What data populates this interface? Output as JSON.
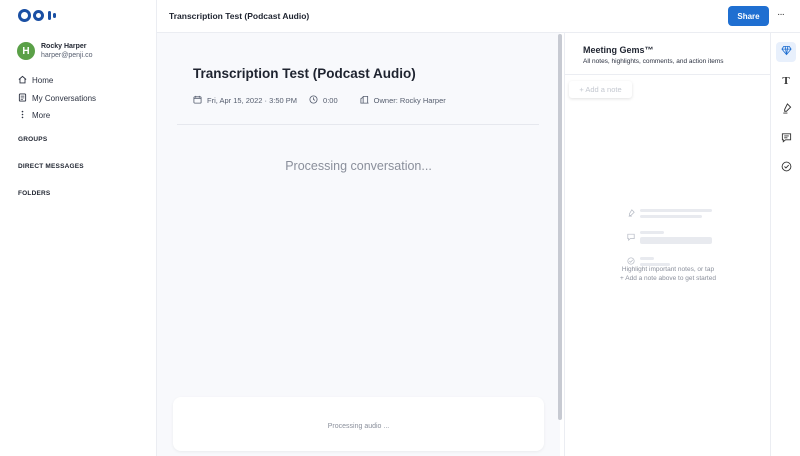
{
  "app": {
    "logo_icon": "otter-logo-icon"
  },
  "user": {
    "initial": "H",
    "name": "Rocky Harper",
    "email": "harper@penji.co"
  },
  "sidebar": {
    "items": [
      {
        "label": "Home",
        "icon": "home-icon"
      },
      {
        "label": "My Conversations",
        "icon": "conversations-icon"
      },
      {
        "label": "More",
        "icon": "more-vertical-icon"
      }
    ],
    "sections": {
      "groups": "GROUPS",
      "direct_messages": "DIRECT MESSAGES",
      "folders": "FOLDERS"
    }
  },
  "header": {
    "title": "Transcription Test (Podcast Audio)",
    "share_label": "Share",
    "more_label": "···"
  },
  "conversation": {
    "title": "Transcription Test (Podcast Audio)",
    "date": "Fri, Apr 15, 2022 · 3:50 PM",
    "duration": "0:00",
    "owner": "Owner: Rocky Harper",
    "status": "Processing conversation...",
    "audio_status": "Processing audio ..."
  },
  "gems": {
    "title": "Meeting Gems™",
    "subtitle": "All notes, highlights, comments, and action items",
    "add_note": "+ Add a note",
    "empty_line1": "Highlight important notes, or tap",
    "empty_line2": "+ Add a note above to get started"
  },
  "colors": {
    "accent": "#1f6fd1",
    "avatar": "#5aa047",
    "logo": "#1a4fa3"
  }
}
